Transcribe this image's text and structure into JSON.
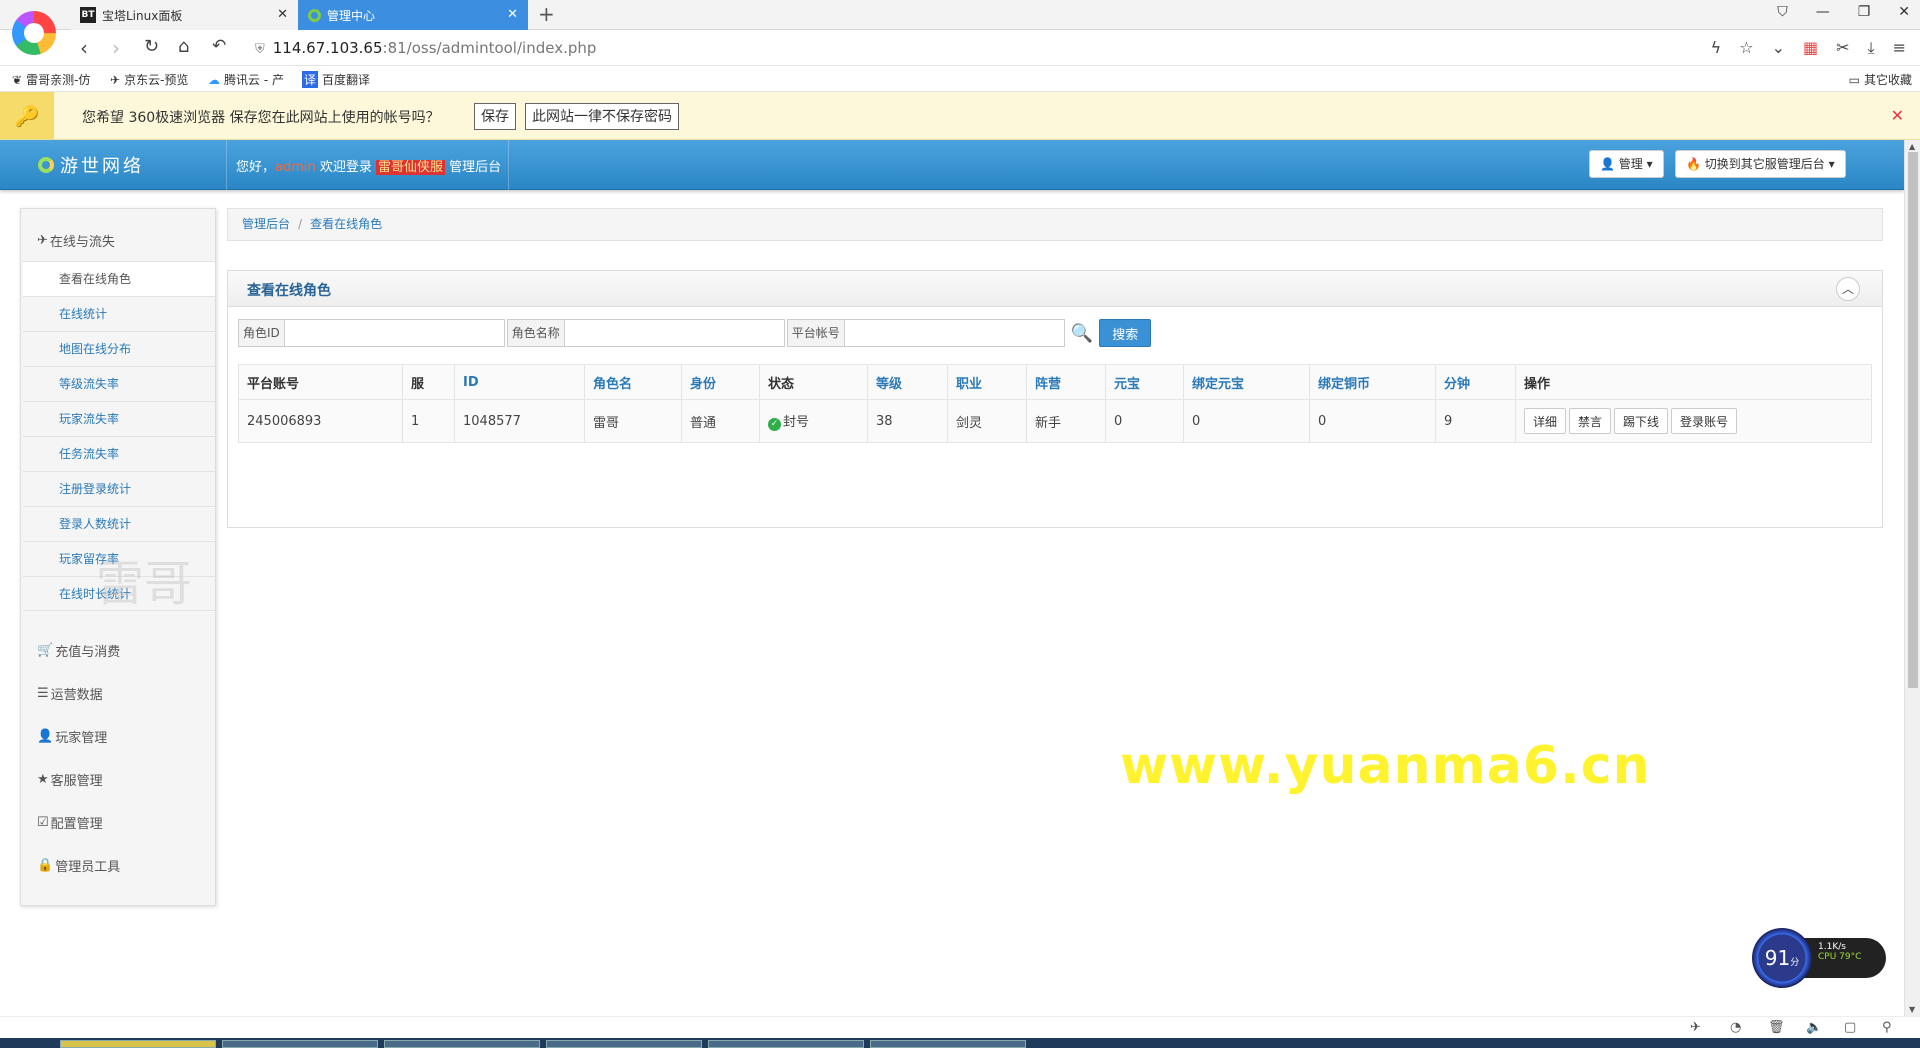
{
  "browser": {
    "tabs": [
      {
        "favicon": "BT",
        "title": "宝塔Linux面板"
      },
      {
        "title": "管理中心"
      }
    ],
    "url_host": "114.67.103.65",
    "url_path": ":81/oss/admintool/index.php",
    "bookmarks": [
      "雷哥亲测-仿",
      "京东云-预览",
      "腾讯云 - 产",
      "百度翻译"
    ],
    "bookmark_other": "其它收藏",
    "password_prompt": {
      "text": "您希望 360极速浏览器 保存您在此网站上使用的帐号吗？",
      "save": "保存",
      "never": "此网站一律不保存密码"
    }
  },
  "header": {
    "brand": "游世网络",
    "welcome_prefix": "您好，",
    "user": "admin",
    "welcome_mid": " 欢迎登录 ",
    "server": "雷哥仙侠服",
    "welcome_suffix": " 管理后台",
    "manage_btn": "管理",
    "switch_btn": "切换到其它服管理后台"
  },
  "sidebar": {
    "groups": {
      "online": "在线与流失",
      "recharge": "充值与消费",
      "ops": "运营数据",
      "players": "玩家管理",
      "service": "客服管理",
      "config": "配置管理",
      "admin": "管理员工具"
    },
    "items": [
      "查看在线角色",
      "在线统计",
      "地图在线分布",
      "等级流失率",
      "玩家流失率",
      "任务流失率",
      "注册登录统计",
      "登录人数统计",
      "玩家留存率",
      "在线时长统计"
    ]
  },
  "breadcrumb": {
    "root": "管理后台",
    "current": "查看在线角色"
  },
  "panel": {
    "title": "查看在线角色",
    "search": {
      "role_id": "角色ID",
      "role_name": "角色名称",
      "platform_account": "平台帐号",
      "button": "搜索"
    },
    "columns": [
      "平台账号",
      "服",
      "ID",
      "角色名",
      "身份",
      "状态",
      "等级",
      "职业",
      "阵营",
      "元宝",
      "绑定元宝",
      "绑定铜币",
      "分钟",
      "操作"
    ],
    "rows": [
      {
        "account": "245006893",
        "server": "1",
        "id": "1048577",
        "name": "雷哥",
        "identity": "普通",
        "status": "封号",
        "level": "38",
        "job": "剑灵",
        "camp": "新手",
        "yuanbao": "0",
        "bind_yuanbao": "0",
        "bind_copper": "0",
        "minutes": "9",
        "actions": [
          "详细",
          "禁言",
          "踢下线",
          "登录账号"
        ]
      }
    ]
  },
  "watermark": "www.yuanma6.cn",
  "ghost_text": "雷哥",
  "widget": {
    "score": "91",
    "score_unit": "分",
    "net": "1.1K/s",
    "cpu": "CPU 79°C"
  }
}
